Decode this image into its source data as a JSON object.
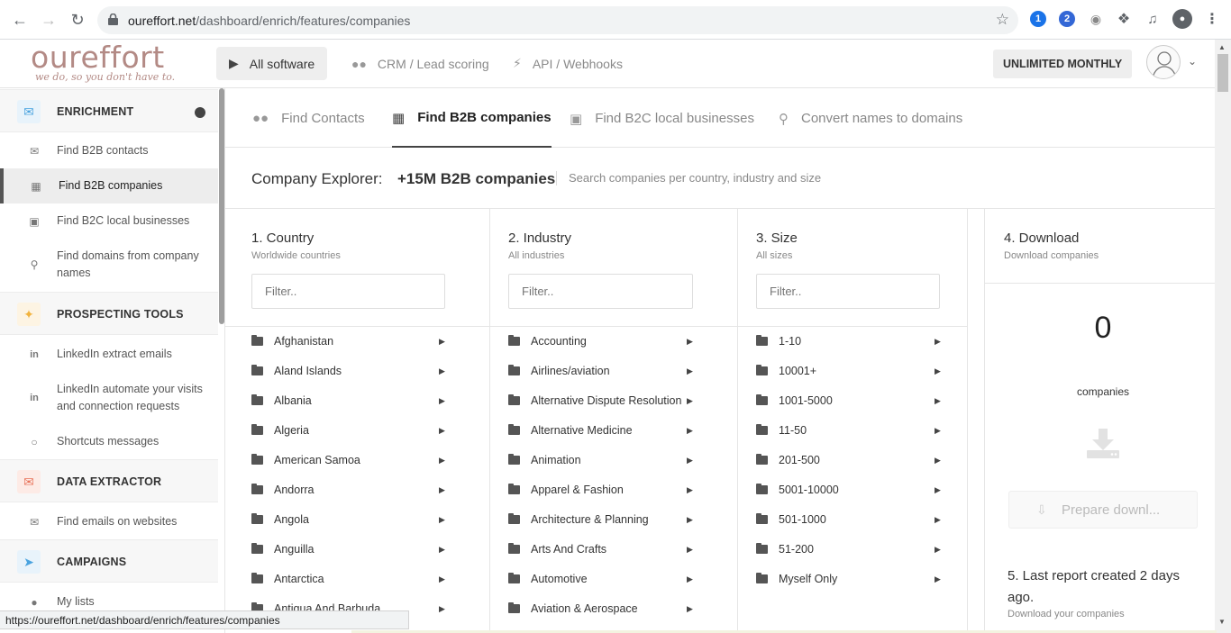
{
  "browser": {
    "url_host": "oureffort.net",
    "url_path": "/dashboard/enrich/features/companies",
    "status_url": "https://oureffort.net/dashboard/enrich/features/companies"
  },
  "header": {
    "logo_word": "oureffort",
    "logo_tagline": "we do, so you don't have to.",
    "nav": [
      {
        "label": "All software",
        "icon": "play-icon"
      },
      {
        "label": "CRM / Lead scoring",
        "icon": "users-icon"
      },
      {
        "label": "API / Webhooks",
        "icon": "plug-icon"
      }
    ],
    "plan": "UNLIMITED MONTHLY"
  },
  "sidebar": {
    "sections": [
      {
        "title": "ENRICHMENT",
        "color": "#4aa3df"
      },
      {
        "title": "PROSPECTING TOOLS",
        "color": "#f2b33d"
      },
      {
        "title": "DATA EXTRACTOR",
        "color": "#e8735a"
      },
      {
        "title": "CAMPAIGNS",
        "color": "#4aa3df"
      }
    ],
    "items": [
      {
        "label": "Find B2B contacts"
      },
      {
        "label": "Find B2B companies"
      },
      {
        "label": "Find B2C local businesses"
      },
      {
        "label": "Find domains from company names"
      },
      {
        "label": "LinkedIn extract emails"
      },
      {
        "label": "LinkedIn automate your visits and connection requests"
      },
      {
        "label": "Shortcuts messages"
      },
      {
        "label": "Find emails on websites"
      },
      {
        "label": "My lists"
      }
    ]
  },
  "tabs": [
    {
      "label": "Find Contacts"
    },
    {
      "label": "Find B2B companies"
    },
    {
      "label": "Find B2C local businesses"
    },
    {
      "label": "Convert names to domains"
    }
  ],
  "explorer": {
    "label": "Company Explorer:",
    "count": "+15M B2B companies",
    "subtitle": "Search companies per country, industry and size"
  },
  "columns": {
    "country": {
      "title": "1. Country",
      "subtitle": "Worldwide countries",
      "placeholder": "Filter..",
      "items": [
        "Afghanistan",
        "Aland Islands",
        "Albania",
        "Algeria",
        "American Samoa",
        "Andorra",
        "Angola",
        "Anguilla",
        "Antarctica",
        "Antigua And Barbuda"
      ]
    },
    "industry": {
      "title": "2. Industry",
      "subtitle": "All industries",
      "placeholder": "Filter..",
      "items": [
        "Accounting",
        "Airlines/aviation",
        "Alternative Dispute Resolution",
        "Alternative Medicine",
        "Animation",
        "Apparel & Fashion",
        "Architecture & Planning",
        "Arts And Crafts",
        "Automotive",
        "Aviation & Aerospace"
      ]
    },
    "size": {
      "title": "3. Size",
      "subtitle": "All sizes",
      "placeholder": "Filter..",
      "items": [
        "1-10",
        "10001+",
        "1001-5000",
        "11-50",
        "201-500",
        "5001-10000",
        "501-1000",
        "51-200",
        "Myself Only"
      ]
    }
  },
  "download": {
    "title": "4. Download",
    "subtitle": "Download companies",
    "count": "0",
    "count_label": "companies",
    "button": "Prepare downl...",
    "last_report": "5. Last report created 2 days ago.",
    "last_sub": "Download your companies"
  }
}
